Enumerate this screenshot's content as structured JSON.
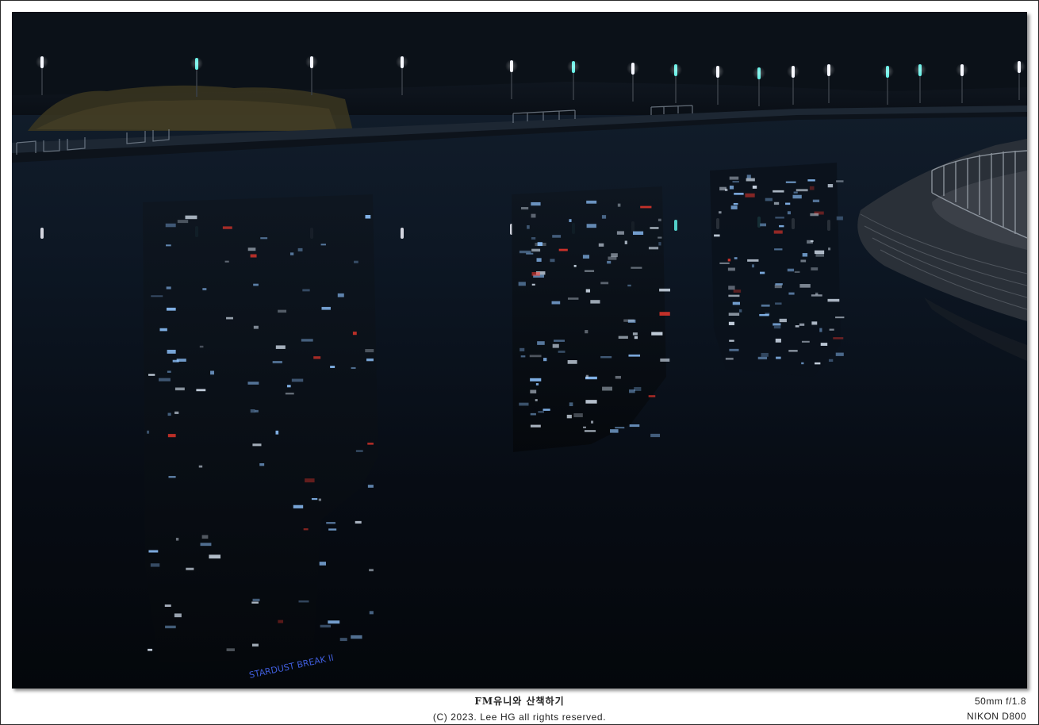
{
  "photo": {
    "alt": "Night river reflection of high-rise apartment buildings with park lamps along the bank",
    "graffiti_text": "STARDUST BREAK II"
  },
  "caption": {
    "title": "FM유니와 산책하기",
    "copyright": "(C) 2023. Lee HG all rights reserved."
  },
  "exif": {
    "lens": "50mm f/1.8",
    "camera": "NIKON D800"
  },
  "colors": {
    "water": "#070b12",
    "lamp_white": "#f4f6ff",
    "lamp_cyan": "#5ff0e6",
    "window_blue": "#8fc4ff",
    "window_red": "#ff3a2e"
  }
}
